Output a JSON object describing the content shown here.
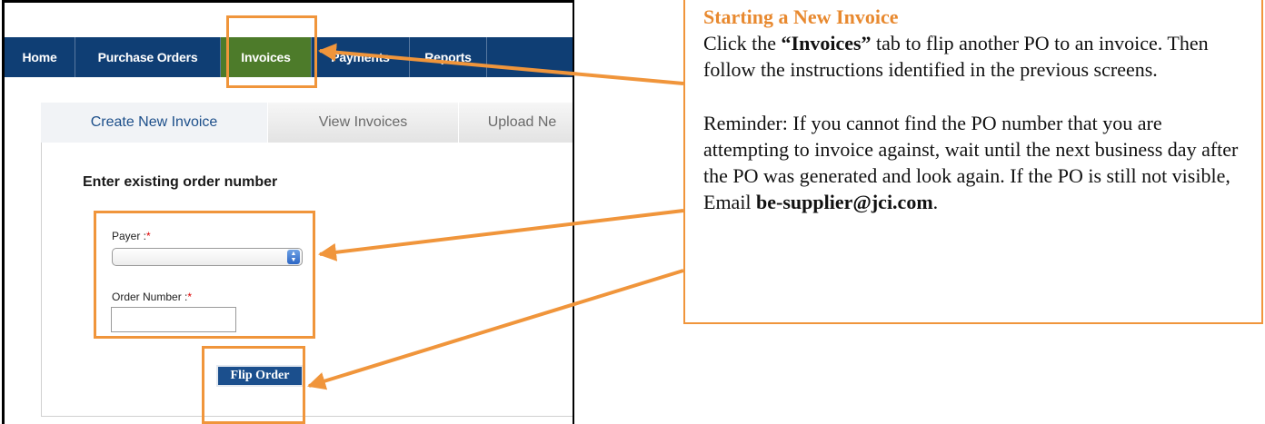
{
  "nav": {
    "items": [
      "Home",
      "Purchase Orders",
      "Invoices",
      "Payments",
      "Reports"
    ],
    "active": "Invoices"
  },
  "tabs": [
    "Create New Invoice",
    "View Invoices",
    "Upload Ne"
  ],
  "form": {
    "title": "Enter existing order number",
    "payer_label": "Payer :",
    "payer_value": "",
    "order_label": "Order Number :",
    "order_value": "",
    "required_mark": "*",
    "submit_label": "Flip Order"
  },
  "callout": {
    "heading": "Starting a New Invoice",
    "p1_pre": "Click the ",
    "p1_bold": "“Invoices”",
    "p1_post": " tab to flip another PO to an invoice. Then follow the instructions identified in the previous screens.",
    "p2_pre": "Reminder: If you cannot find the PO number that you are attempting to invoice against, wait until the next business day after the PO was generated and look again. If the PO is still not visible, Email ",
    "p2_bold": "be-supplier@jci.com",
    "p2_post": "."
  },
  "colors": {
    "nav_bg": "#0f3e74",
    "nav_active": "#4d7b2a",
    "highlight": "#f0953b",
    "heading": "#e8892f",
    "button": "#1b4f8d"
  }
}
